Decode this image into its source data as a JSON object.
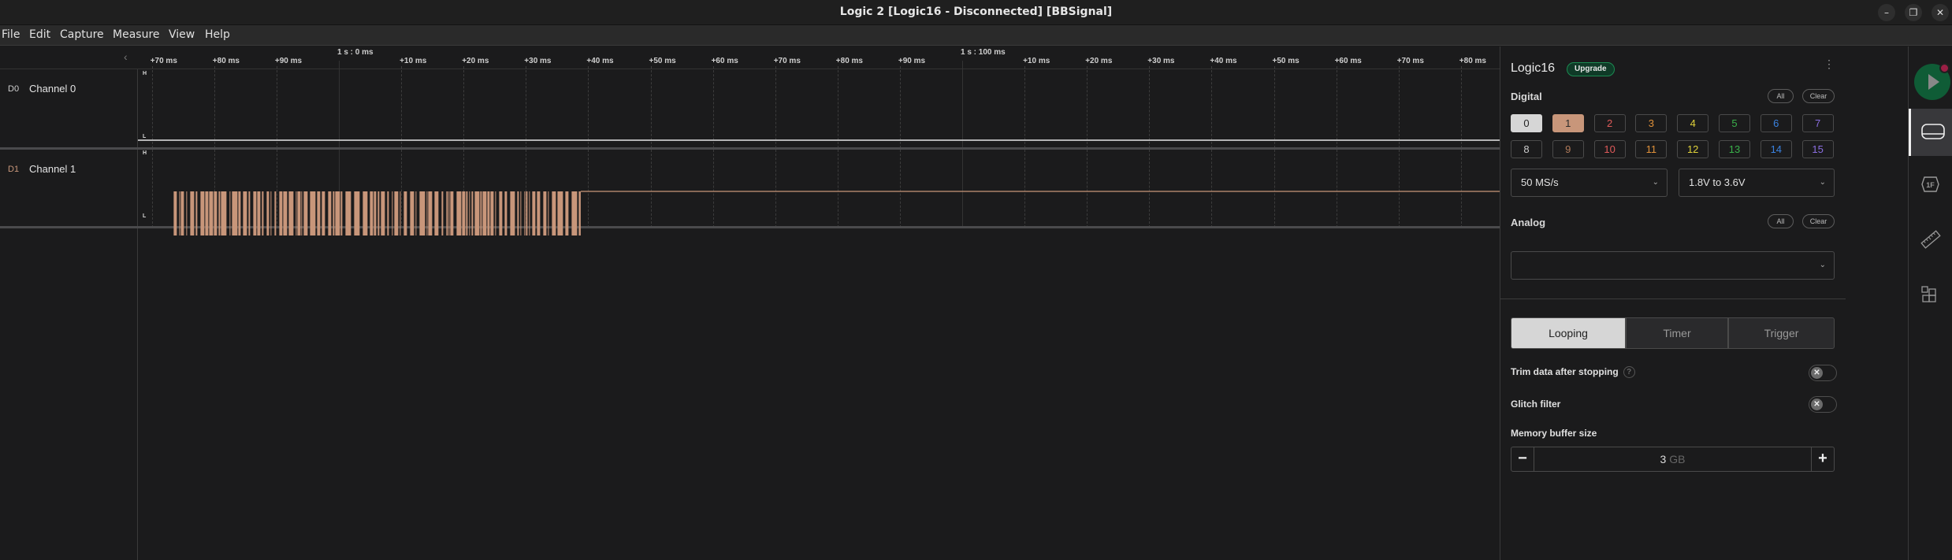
{
  "window": {
    "title": "Logic 2 [Logic16 - Disconnected] [BBSignal]",
    "controls": {
      "minimize": "–",
      "maximize": "❐",
      "close": "✕"
    }
  },
  "menu": [
    "File",
    "Edit",
    "Capture",
    "Measure",
    "View",
    "Help"
  ],
  "timeline": {
    "major_labels": [
      "1 s : 0 ms",
      "1 s : 100 ms"
    ],
    "tick_labels": [
      "+70 ms",
      "+80 ms",
      "+90 ms",
      "+10 ms",
      "+20 ms",
      "+30 ms",
      "+40 ms",
      "+50 ms",
      "+60 ms",
      "+70 ms",
      "+80 ms",
      "+90 ms",
      "+10 ms",
      "+20 ms",
      "+30 ms",
      "+40 ms",
      "+50 ms",
      "+60 ms",
      "+70 ms",
      "+80 ms"
    ],
    "collapse_icon": "‹"
  },
  "channels": [
    {
      "id": "D0",
      "name": "Channel 0",
      "color": "#e6e6e6",
      "id_color": "#cfcfcf",
      "high_label": "H",
      "low_label": "L",
      "state": "low"
    },
    {
      "id": "D1",
      "name": "Channel 1",
      "color": "#c8967a",
      "id_color": "#c8967a",
      "high_label": "H",
      "low_label": "L",
      "state": "burst-then-high"
    }
  ],
  "signal_d1": {
    "burst_start_ms": -26.5,
    "burst_end_ms": 38.8,
    "after_state": "high"
  },
  "panel": {
    "device": "Logic16",
    "badge": "Upgrade",
    "menu_icon": "⋮",
    "digital": {
      "label": "Digital",
      "all_label": "All",
      "clear_label": "Clear",
      "channels": [
        {
          "n": "0",
          "color": "#222222",
          "state": "enabled-white"
        },
        {
          "n": "1",
          "color": "#2a2a2a",
          "state": "enabled-orange"
        },
        {
          "n": "2",
          "color": "#e05a5a"
        },
        {
          "n": "3",
          "color": "#e0913a"
        },
        {
          "n": "4",
          "color": "#e0d23a"
        },
        {
          "n": "5",
          "color": "#3ab04a"
        },
        {
          "n": "6",
          "color": "#3a82e0"
        },
        {
          "n": "7",
          "color": "#8a6ee0"
        },
        {
          "n": "8",
          "color": "#cccccc"
        },
        {
          "n": "9",
          "color": "#b07a5a"
        },
        {
          "n": "10",
          "color": "#e05a5a"
        },
        {
          "n": "11",
          "color": "#e0913a"
        },
        {
          "n": "12",
          "color": "#e0d23a"
        },
        {
          "n": "13",
          "color": "#3ab04a"
        },
        {
          "n": "14",
          "color": "#3a82e0"
        },
        {
          "n": "15",
          "color": "#8a6ee0"
        }
      ]
    },
    "sample_rate": "50 MS/s",
    "voltage": "1.8V to 3.6V",
    "analog": {
      "label": "Analog",
      "all_label": "All",
      "clear_label": "Clear",
      "select_value": ""
    },
    "modes": [
      {
        "label": "Looping",
        "active": true
      },
      {
        "label": "Timer",
        "active": false
      },
      {
        "label": "Trigger",
        "active": false
      }
    ],
    "trim": {
      "label": "Trim data after stopping",
      "help": "?",
      "enabled": false
    },
    "glitch": {
      "label": "Glitch filter",
      "enabled": false
    },
    "memory": {
      "label": "Memory buffer size",
      "value": "3",
      "unit": "GB",
      "minus": "−",
      "plus": "+"
    }
  },
  "rail": {
    "items": [
      "start-capture",
      "device-settings",
      "analyzers",
      "measurements",
      "extensions"
    ],
    "analyzers_glyph": "1F"
  }
}
